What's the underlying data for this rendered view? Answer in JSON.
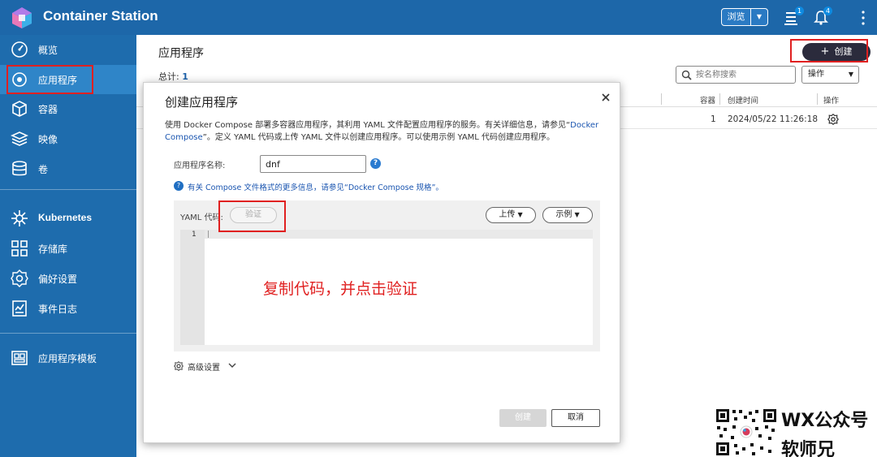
{
  "app": {
    "title": "Container Station"
  },
  "topbar": {
    "browse_label": "浏览",
    "stack_badge": "1",
    "bell_badge": "4"
  },
  "sidebar": {
    "items": [
      {
        "label": "概览",
        "icon": "dashboard-icon"
      },
      {
        "label": "应用程序",
        "icon": "application-icon",
        "active": true
      },
      {
        "label": "容器",
        "icon": "container-icon"
      },
      {
        "label": "映像",
        "icon": "image-layers-icon"
      },
      {
        "label": "卷",
        "icon": "volume-icon"
      },
      {
        "label": "Kubernetes",
        "icon": "kubernetes-icon"
      },
      {
        "label": "存储库",
        "icon": "repository-icon"
      },
      {
        "label": "偏好设置",
        "icon": "preferences-icon"
      },
      {
        "label": "事件日志",
        "icon": "event-log-icon"
      },
      {
        "label": "应用程序模板",
        "icon": "template-icon"
      }
    ]
  },
  "main": {
    "title": "应用程序",
    "create_label": "创建",
    "total_label": "总计:",
    "total_value": "1",
    "search_placeholder": "按名称搜索",
    "ops_label": "操作",
    "columns": {
      "containers": "容器",
      "created": "创建时间",
      "ops": "操作"
    },
    "rows": [
      {
        "containers": "1",
        "created": "2024/05/22 11:26:18"
      }
    ]
  },
  "modal": {
    "title": "创建应用程序",
    "desc_part1": "使用 Docker Compose 部署多容器应用程序，其利用 YAML 文件配置应用程序的服务。有关详细信息，请参见“",
    "desc_link1": "Docker Compose",
    "desc_part2": "”。定义 YAML 代码或上传 YAML 文件以创建应用程序。可以使用示例 YAML 代码创建应用程序。",
    "name_label": "应用程序名称:",
    "name_value": "dnf",
    "info_text_prefix": "有关 Compose 文件格式的更多信息，请参见“",
    "info_link": "Docker Compose 规格",
    "info_text_suffix": "”。",
    "yaml_label": "YAML 代码:",
    "verify_label": "验证",
    "upload_label": "上传",
    "example_label": "示例",
    "line_number": "1",
    "annotation": "复制代码，并点击验证",
    "advanced_label": "高级设置",
    "create_label": "创建",
    "cancel_label": "取消"
  },
  "watermark": {
    "line1": "WX公众号",
    "line2": "软师兄"
  },
  "colors": {
    "topbar": "#1d67a9",
    "sidebar": "#1e6cad",
    "sidebar_active": "#2f85c8",
    "annotation_red": "#e02020",
    "create_button": "#2b2b3c"
  }
}
